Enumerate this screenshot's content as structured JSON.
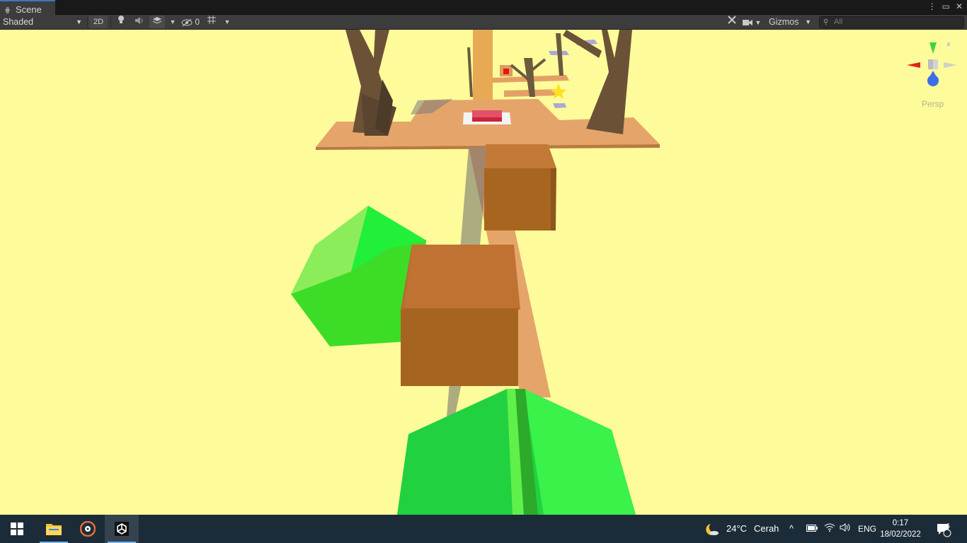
{
  "tab": {
    "title": "Scene",
    "icon": "grid-icon"
  },
  "window_controls": {
    "menu": "⋮",
    "maximize": "▭",
    "close": "✕"
  },
  "toolbar": {
    "shading_mode": "Shaded",
    "mode_2d": "2D",
    "hidden_count": "0",
    "gizmos_label": "Gizmos",
    "search_placeholder": "All"
  },
  "viewport": {
    "sky_color": "#fdfb9a",
    "projection_label": "Persp"
  },
  "taskbar": {
    "weather_temp": "24°C",
    "weather_desc": "Cerah",
    "language": "ENG",
    "time": "0:17",
    "date": "18/02/2022",
    "notification_count": "5"
  }
}
